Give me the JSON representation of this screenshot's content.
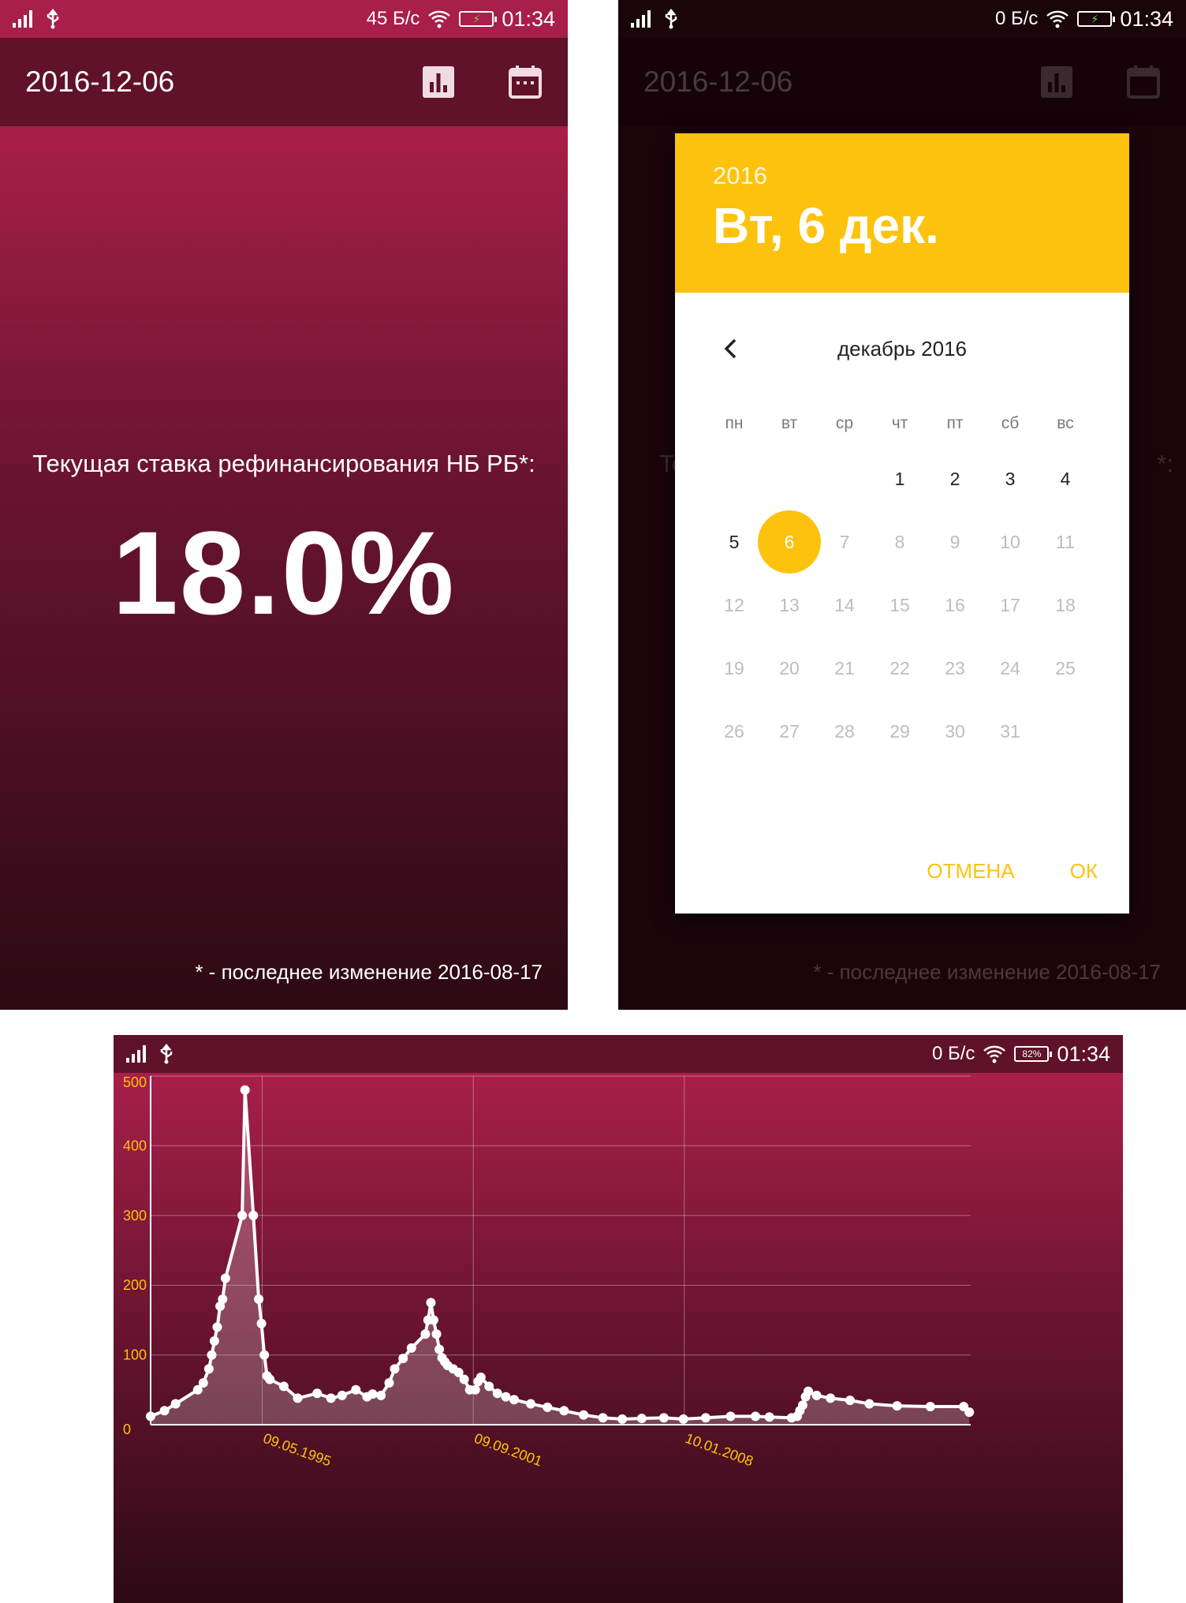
{
  "status1": {
    "speed": "45 Б/с",
    "time": "01:34"
  },
  "status2": {
    "speed": "0 Б/с",
    "time": "01:34"
  },
  "status3": {
    "speed": "0 Б/с",
    "battery": "82%",
    "time": "01:34"
  },
  "screen1": {
    "date_title": "2016-12-06",
    "chart_icon": "bar-chart-icon",
    "calendar_icon": "calendar-icon",
    "rate_label": "Текущая ставка рефинансирования НБ РБ*:",
    "rate_value": "18.0%",
    "footnote": "* - последнее изменение 2016-08-17"
  },
  "screen2": {
    "date_title": "2016-12-06",
    "bg_left": "Te",
    "bg_right": "*:",
    "footnote": "* - последнее изменение 2016-08-17",
    "dialog": {
      "year": "2016",
      "selected_date": "Вт, 6 дек.",
      "month_title": "декабрь 2016",
      "weekdays": [
        "пн",
        "вт",
        "ср",
        "чт",
        "пт",
        "сб",
        "вс"
      ],
      "weeks": [
        [
          "",
          "",
          "",
          "1",
          "2",
          "3",
          "4"
        ],
        [
          "5",
          "6",
          "7",
          "8",
          "9",
          "10",
          "11"
        ],
        [
          "12",
          "13",
          "14",
          "15",
          "16",
          "17",
          "18"
        ],
        [
          "19",
          "20",
          "21",
          "22",
          "23",
          "24",
          "25"
        ],
        [
          "26",
          "27",
          "28",
          "29",
          "30",
          "31",
          ""
        ]
      ],
      "selected_day": "6",
      "cancel": "ОТМЕНА",
      "ok": "ОК"
    }
  },
  "colors": {
    "accent": "#fdc20d",
    "brand": "#a81f49",
    "appbar": "#5f1229",
    "axis_label": "#fdc20d"
  },
  "chart_data": {
    "type": "area",
    "y_ticks": [
      "500",
      "400",
      "300",
      "200",
      "100",
      "0"
    ],
    "ylim": [
      0,
      500
    ],
    "x_tick_labels": [
      "09.05.1995",
      "09.09.2001",
      "10.01.2008"
    ],
    "grid": true,
    "x": [
      "1992-01",
      "1992-06",
      "1992-10",
      "1993-06",
      "1993-08",
      "1993-10",
      "1993-11",
      "1993-12",
      "1994-01",
      "1994-02",
      "1994-03",
      "1994-04",
      "1994-10",
      "1994-11",
      "1995-02",
      "1995-04",
      "1995-05",
      "1995-06",
      "1995-07",
      "1995-08",
      "1996-01",
      "1996-06",
      "1997-01",
      "1997-06",
      "1997-10",
      "1998-03",
      "1998-07",
      "1998-09",
      "1998-12",
      "1999-03",
      "1999-05",
      "1999-08",
      "1999-11",
      "2000-04",
      "2000-05",
      "2000-06",
      "2000-07",
      "2000-08",
      "2000-09",
      "2000-10",
      "2000-11",
      "2000-12",
      "2001-02",
      "2001-04",
      "2001-06",
      "2001-08",
      "2001-10",
      "2001-11",
      "2001-12",
      "2002-03",
      "2002-06",
      "2002-09",
      "2002-12",
      "2003-06",
      "2003-12",
      "2004-06",
      "2005-01",
      "2005-08",
      "2006-03",
      "2006-10",
      "2007-06",
      "2008-01",
      "2008-09",
      "2009-06",
      "2010-03",
      "2010-08",
      "2011-04",
      "2011-06",
      "2011-07",
      "2011-08",
      "2011-09",
      "2011-10",
      "2012-01",
      "2012-06",
      "2013-01",
      "2013-08",
      "2014-06",
      "2015-06",
      "2016-06",
      "2016-08"
    ],
    "values": [
      12,
      20,
      30,
      50,
      60,
      80,
      100,
      120,
      140,
      170,
      180,
      210,
      300,
      480,
      300,
      180,
      145,
      100,
      70,
      65,
      55,
      38,
      45,
      38,
      42,
      50,
      40,
      44,
      42,
      60,
      80,
      95,
      110,
      130,
      150,
      175,
      150,
      130,
      108,
      96,
      90,
      85,
      80,
      75,
      65,
      50,
      50,
      62,
      68,
      55,
      45,
      40,
      36,
      30,
      25,
      20,
      14,
      10,
      8,
      9,
      10,
      8,
      10,
      12,
      12,
      11,
      10,
      12,
      20,
      28,
      40,
      48,
      42,
      38,
      35,
      30,
      27,
      26,
      26,
      18
    ]
  }
}
